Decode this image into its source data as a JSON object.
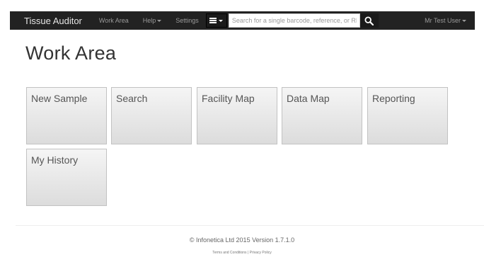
{
  "navbar": {
    "brand": "Tissue Auditor",
    "work_area": "Work Area",
    "help": "Help",
    "settings": "Settings",
    "search_placeholder": "Search for a single barcode, reference, or RFID",
    "user": "Mr Test User"
  },
  "page": {
    "title": "Work Area"
  },
  "tiles": [
    {
      "label": "New Sample"
    },
    {
      "label": "Search"
    },
    {
      "label": "Facility Map"
    },
    {
      "label": "Data Map"
    },
    {
      "label": "Reporting"
    },
    {
      "label": "My History"
    }
  ],
  "footer": {
    "copyright": "© Infonetica Ltd 2015 Version 1.7.1.0",
    "terms": "Terms and Conditions",
    "separator": "|",
    "privacy": "Privacy Policy"
  }
}
